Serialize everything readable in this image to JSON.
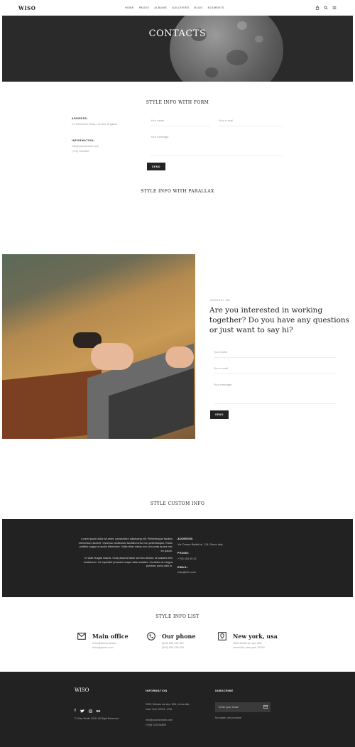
{
  "header": {
    "logo": "WISO",
    "nav": [
      "HOME",
      "PAGES",
      "ALBUMS",
      "GALLERIES",
      "BLOG",
      "ELEMENTS"
    ],
    "icons": [
      "bag-icon",
      "search-icon",
      "menu-icon"
    ]
  },
  "hero": {
    "title": "CONTACTS"
  },
  "form_section": {
    "title": "STYLE INFO WITH FORM",
    "address_label": "ADDRESS:",
    "address_value": "24 Tottenham Road, London, England",
    "info_label": "INFORMATION:",
    "info_email": "info@yourdomain.com",
    "info_phone": "(+44) 1234567",
    "name_placeholder": "Your name",
    "email_placeholder": "Your e-mail",
    "message_placeholder": "Your message",
    "send_label": "SEND"
  },
  "parallax": {
    "title": "STYLE INFO WITH PARALLAX",
    "kicker": "CONTACT ME",
    "heading_1": "Are you interested in working",
    "heading_2": "together? Do you have any questions",
    "heading_3": "or just want to say hi?",
    "name_placeholder": "Your name",
    "email_placeholder": "Your e-mail",
    "message_placeholder": "Your message",
    "send_label": "SEND"
  },
  "custom": {
    "title": "STYLE CUSTOM INFO",
    "para1_l1": "Lorem ipsum dolor sit amet, consectetur adipiscing elit. Pellentesque facilisis",
    "para1_l2": "elementum laoreet. Vivamus vestibulum facilisis tortor non pellentesque. Etiam",
    "para1_l3": "porttitor augue a iaculis bibendum. Nulla vitae metus non orci porta auctor nec",
    "para1_l4": "eu ipsum.",
    "para2_l1": "In vitae feugiat mauris. Cras placerat dolor sed leo dictum, id sodales felis",
    "para2_l2": "vestibulum. Ut imperdiet pharetra neque vitae sodales. Curabitur at magna",
    "para2_l3": "pulvinar, porta odio in.",
    "address_label": "ADDRESS:",
    "address_value": "Via Cesare Battisti st. 118, Rome Italy",
    "phone_label": "PHONE:",
    "phone_value": "+795 453 45 43",
    "email_label": "EMAIL:",
    "email_value": "wiso@info.com"
  },
  "info_list": {
    "title": "STYLE INFO LIST",
    "items": [
      {
        "title": "Main office",
        "line1": "hello@theme.studio",
        "line2": "hello@photo.com"
      },
      {
        "title": "Our phone",
        "line1": "(843) 555 455 567",
        "line2": "(843) 555 436 903"
      },
      {
        "title": "New york, usa",
        "line1": "2505 stoskt ste apt. 806,",
        "line2": "vemeville, new york 10015"
      }
    ]
  },
  "footer": {
    "logo": "WISO",
    "copyright": "© Wiso Studio 2018. All Right Reserved.",
    "info_title": "INFORMATION",
    "addr1": "2505 Stoksts ste Apt. 806, Vemeville,",
    "addr2": "New York 10015, USA",
    "email": "info@yourdomain.com",
    "phone": "(+68) 120034509",
    "subscribe_title": "SUBSCRIBE",
    "email_placeholder": "Enter your email",
    "no_spam": "No spam, we promise"
  }
}
